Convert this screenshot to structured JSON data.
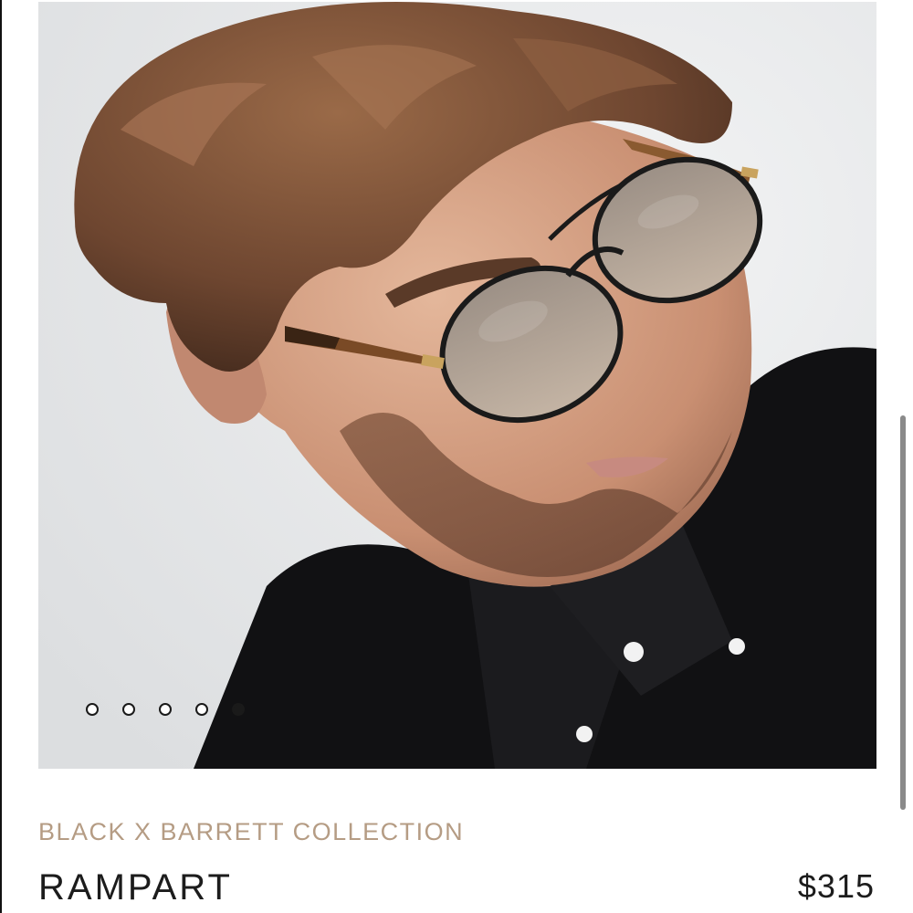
{
  "carousel": {
    "image_alt": "Model wearing Rampart sunglasses",
    "slide_count": 5,
    "active_slide": 5
  },
  "product": {
    "collection": "BLACK X BARRETT COLLECTION",
    "name": "RAMPART",
    "price": "$315"
  },
  "colors": {
    "collection_text": "#b59c84",
    "name_text": "#1c1c1c",
    "hero_background": "#e9eaec"
  }
}
